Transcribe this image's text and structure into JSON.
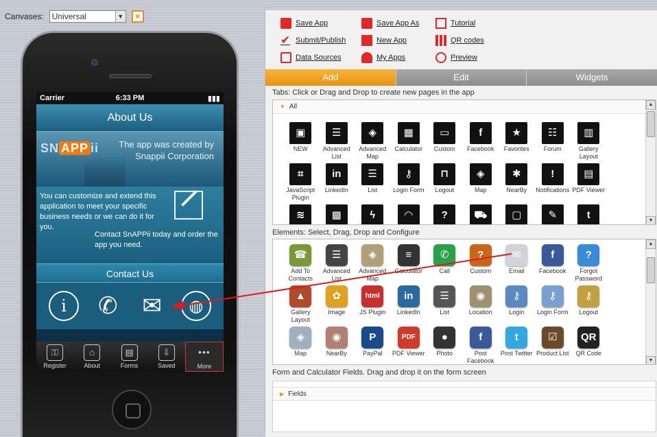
{
  "canvas": {
    "label": "Canvases:",
    "value": "Universal",
    "close": "×"
  },
  "phone": {
    "status": {
      "carrier": "Carrier",
      "time": "6:33 PM",
      "battery": "▮▮▮"
    },
    "about_title": "About Us",
    "logo": {
      "prefix": "SN",
      "app": "APP",
      "suffix": "ii"
    },
    "banner_text": "The app was created by Snappii Corporation",
    "body_text1": "You can customize and extend this application to meet your specific business needs or we can do it for you.",
    "body_text2": "Contact SnAPPii today and order the app you need.",
    "contact_title": "Contact Us",
    "contact_icons": [
      "i",
      "✆",
      "✉",
      "◍"
    ],
    "tabs": [
      "Register",
      "About",
      "Forms",
      "Saved",
      "More"
    ],
    "tab_icons": [
      "⚿",
      "⌂",
      "▤",
      "⇩",
      "•••"
    ]
  },
  "toolbar": {
    "col1": [
      "Save App",
      "Submit/Publish",
      "Data Sources"
    ],
    "col2": [
      "Save App As",
      "New App",
      "My Apps"
    ],
    "col3": [
      "Tutorial",
      "QR codes",
      "Preview"
    ],
    "check_glyph": "✔"
  },
  "main_tabs": [
    "Add",
    "Edit",
    "Widgets"
  ],
  "tabs_section": {
    "title": "Tabs: Click or Drag and Drop to create new pages in the app",
    "accordion": "All",
    "items": [
      {
        "label": "NEW",
        "glyph": "▣"
      },
      {
        "label": "Advanced List",
        "glyph": "☰"
      },
      {
        "label": "Advanced Map",
        "glyph": "◈"
      },
      {
        "label": "Calculator",
        "glyph": "▦"
      },
      {
        "label": "Custom",
        "glyph": "▭"
      },
      {
        "label": "Facebook",
        "glyph": "f"
      },
      {
        "label": "Favorites",
        "glyph": "★"
      },
      {
        "label": "Forum",
        "glyph": "☷"
      },
      {
        "label": "Gallery Layout",
        "glyph": "▥"
      },
      {
        "label": "JavaScript Plugin",
        "glyph": "⌗"
      },
      {
        "label": "LinkedIn",
        "glyph": "in"
      },
      {
        "label": "List",
        "glyph": "☰"
      },
      {
        "label": "Login Form",
        "glyph": "⚷"
      },
      {
        "label": "Logout",
        "glyph": "⊓"
      },
      {
        "label": "Map",
        "glyph": "◈"
      },
      {
        "label": "NearBy",
        "glyph": "✱"
      },
      {
        "label": "Notifications",
        "glyph": "!"
      },
      {
        "label": "PDF Viewer",
        "glyph": "▤"
      },
      {
        "label": "",
        "glyph": "≋"
      },
      {
        "label": "",
        "glyph": "▩"
      },
      {
        "label": "",
        "glyph": "ϟ"
      },
      {
        "label": "",
        "glyph": "◠"
      },
      {
        "label": "",
        "glyph": "?"
      },
      {
        "label": "",
        "glyph": "⛟"
      },
      {
        "label": "",
        "glyph": "▢"
      },
      {
        "label": "",
        "glyph": "✎"
      },
      {
        "label": "",
        "glyph": "t"
      }
    ]
  },
  "elements_section": {
    "title": "Elements: Select, Drag, Drop and Configure",
    "items": [
      {
        "label": "Add To Contacts",
        "glyph": "☎",
        "color": "#7a9a3a"
      },
      {
        "label": "Advanced List",
        "glyph": "☰",
        "color": "#444444"
      },
      {
        "label": "Advanced Map",
        "glyph": "◈",
        "color": "#b0a07a"
      },
      {
        "label": "Calculator",
        "glyph": "≡",
        "color": "#333333"
      },
      {
        "label": "Call",
        "glyph": "✆",
        "color": "#2aa04a"
      },
      {
        "label": "Custom",
        "glyph": "?",
        "color": "#c8661a"
      },
      {
        "label": "Email",
        "glyph": "✉",
        "color": "#d0d4da"
      },
      {
        "label": "Facebook",
        "glyph": "f",
        "color": "#3b5998"
      },
      {
        "label": "Forgot Password",
        "glyph": "?",
        "color": "#3a8ad8"
      },
      {
        "label": "Gallery Layout",
        "glyph": "▲",
        "color": "#b04a2a"
      },
      {
        "label": "Image",
        "glyph": "✿",
        "color": "#e0a020"
      },
      {
        "label": "JS Plugin",
        "glyph": "html",
        "color": "#c83030"
      },
      {
        "label": "LinkedIn",
        "glyph": "in",
        "color": "#2a6aa0"
      },
      {
        "label": "List",
        "glyph": "☰",
        "color": "#555555"
      },
      {
        "label": "Location",
        "glyph": "◉",
        "color": "#a09070"
      },
      {
        "label": "Login",
        "glyph": "⚷",
        "color": "#5a8ac0"
      },
      {
        "label": "Login Form",
        "glyph": "⚷",
        "color": "#7aa0d0"
      },
      {
        "label": "Logout",
        "glyph": "⚷",
        "color": "#c0a040"
      },
      {
        "label": "Map",
        "glyph": "◈",
        "color": "#a0b0c0"
      },
      {
        "label": "NearBy",
        "glyph": "◉",
        "color": "#b08070"
      },
      {
        "label": "PayPal",
        "glyph": "P",
        "color": "#1a4a8a"
      },
      {
        "label": "PDF Viewer",
        "glyph": "PDF",
        "color": "#d03a2a"
      },
      {
        "label": "Photo",
        "glyph": "●",
        "color": "#333333"
      },
      {
        "label": "Post Facebook",
        "glyph": "f",
        "color": "#3b5998"
      },
      {
        "label": "Post Twitter",
        "glyph": "t",
        "color": "#33a8e0"
      },
      {
        "label": "Product List",
        "glyph": "☑",
        "color": "#6a4a2a"
      },
      {
        "label": "QR Code",
        "glyph": "QR",
        "color": "#222222"
      }
    ]
  },
  "form_section": {
    "title": "Form and Calculator Fields. Drag and drop it on the form screen",
    "accordion": "Fields"
  },
  "colors": {
    "accent": "#f39c1e",
    "toolbar_icon": "#e02828",
    "arrow": "#e01a1a"
  }
}
